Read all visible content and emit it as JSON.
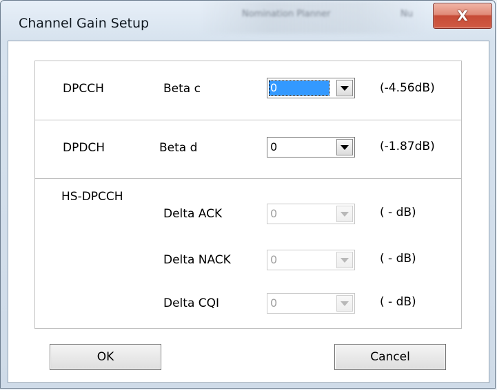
{
  "window": {
    "title": "Channel Gain Setup",
    "background_titles": [
      "Nomination Planner",
      "Nu"
    ]
  },
  "groups": {
    "dpcch": {
      "name": "DPCCH",
      "param_label": "Beta c",
      "value": "0",
      "db": "(-4.56dB)"
    },
    "dpdch": {
      "name": "DPDCH",
      "param_label": "Beta d",
      "value": "0",
      "db": "(-1.87dB)"
    },
    "hs_dpcch": {
      "name": "HS-DPCCH",
      "rows": [
        {
          "label": "Delta ACK",
          "value": "0",
          "db": "( - dB)"
        },
        {
          "label": "Delta NACK",
          "value": "0",
          "db": "( - dB)"
        },
        {
          "label": "Delta CQI",
          "value": "0",
          "db": "( - dB)"
        }
      ]
    }
  },
  "buttons": {
    "ok": "OK",
    "cancel": "Cancel"
  },
  "colors": {
    "selection": "#3399ff",
    "close_button": "#c74c37"
  }
}
